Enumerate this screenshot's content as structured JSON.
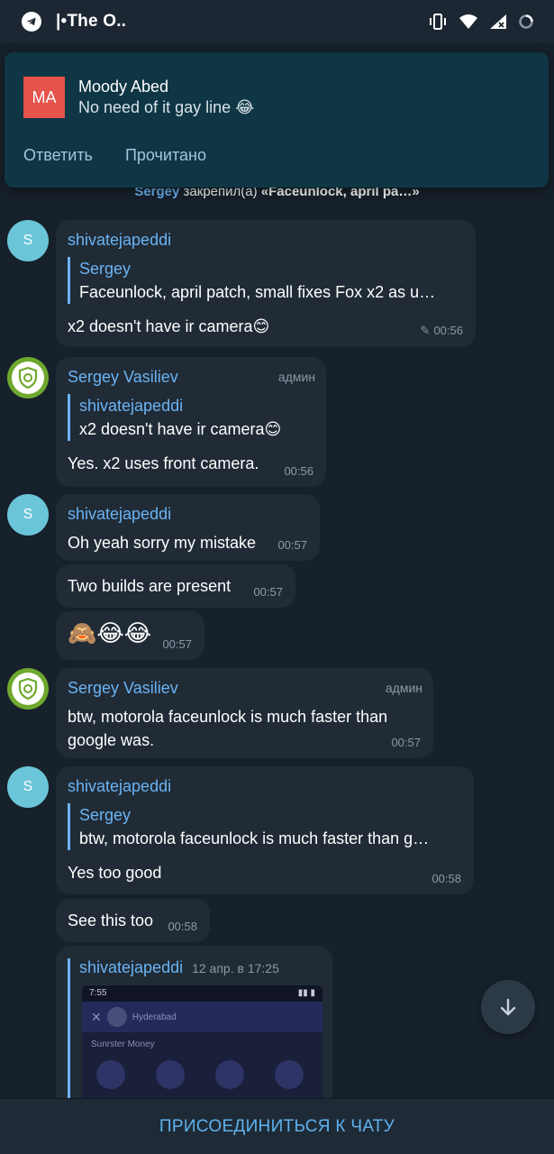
{
  "status_bar": {
    "title": "|•The O.."
  },
  "notification": {
    "avatar_initials": "MA",
    "sender": "Moody Abed",
    "message": "No need of it gay line 😂",
    "actions": [
      "Ответить",
      "Прочитано"
    ]
  },
  "service": {
    "who": "Sergey",
    "action": " закрепил(а) ",
    "pinned": "«Faceunlock, april pa…»"
  },
  "messages": [
    {
      "avatar": "S",
      "sender": "shivatejapeddi",
      "reply_name": "Sergey",
      "reply_text": "Faceunlock, april patch, small fixes  Fox x2 as u…",
      "text": "x2 doesn't have ir camera😊",
      "time": "00:56",
      "edited_icon": "pencil-icon"
    },
    {
      "sender": "Sergey Vasiliev",
      "admin": "админ",
      "reply_name": "shivatejapeddi",
      "reply_text": "x2 doesn't have ir camera😊",
      "text": "Yes. x2 uses front camera.",
      "time": "00:56"
    },
    {
      "avatar": "S",
      "sender": "shivatejapeddi",
      "text": "Oh yeah sorry my mistake",
      "time": "00:57"
    },
    {
      "text": "Two builds are present",
      "time": "00:57"
    },
    {
      "text": "🙈😂😂",
      "time": "00:57"
    },
    {
      "sender": "Sergey Vasiliev",
      "admin": "админ",
      "text": "btw, motorola faceunlock is much faster than google was.",
      "time": "00:57"
    },
    {
      "avatar": "S",
      "sender": "shivatejapeddi",
      "reply_name": "Sergey",
      "reply_text": "btw, motorola faceunlock is much faster than g…",
      "text": "Yes too good",
      "time": "00:58"
    },
    {
      "text": "See this too",
      "time": "00:58"
    },
    {
      "forward_name": "shivatejapeddi",
      "forward_date": "12 апр. в 17:25",
      "preview_time": "7:55",
      "preview_label": "Hyderabad",
      "preview_text": "Sunrster Money"
    }
  ],
  "join_button": "ПРИСОЕДИНИТЬСЯ К ЧАТУ",
  "colors": {
    "background": "#17212b",
    "bubble": "#202b36",
    "accent": "#6ab3f3",
    "notification": "#0f3644"
  }
}
